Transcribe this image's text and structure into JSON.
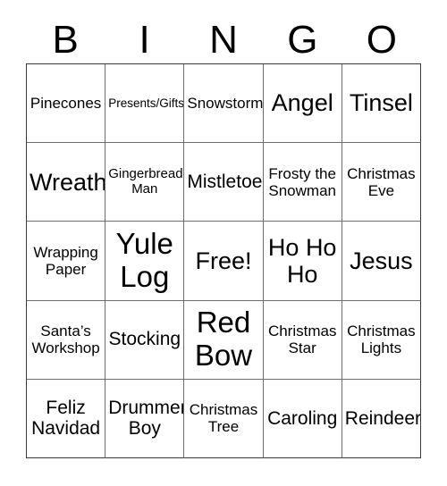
{
  "header": {
    "letters": [
      "B",
      "I",
      "N",
      "G",
      "O"
    ]
  },
  "grid": {
    "rows": 5,
    "columns": 5,
    "cells": [
      {
        "text": "Pinecones",
        "size": "md",
        "free": false
      },
      {
        "text": "Presents/Gifts",
        "size": "xs",
        "free": false
      },
      {
        "text": "Snowstorm",
        "size": "md",
        "free": false
      },
      {
        "text": "Angel",
        "size": "xl",
        "free": false
      },
      {
        "text": "Tinsel",
        "size": "xl",
        "free": false
      },
      {
        "text": "Wreath",
        "size": "xl",
        "free": false
      },
      {
        "text": "Gingerbread\nMan",
        "size": "sm",
        "free": false
      },
      {
        "text": "Mistletoe",
        "size": "lg",
        "free": false
      },
      {
        "text": "Frosty the\nSnowman",
        "size": "md",
        "free": false
      },
      {
        "text": "Christmas\nEve",
        "size": "md",
        "free": false
      },
      {
        "text": "Wrapping\nPaper",
        "size": "md",
        "free": false
      },
      {
        "text": "Yule\nLog",
        "size": "xxl",
        "free": false
      },
      {
        "text": "Free!",
        "size": "xl",
        "free": true
      },
      {
        "text": "Ho Ho\nHo",
        "size": "xl",
        "free": false
      },
      {
        "text": "Jesus",
        "size": "xl",
        "free": false
      },
      {
        "text": "Santa’s\nWorkshop",
        "size": "md",
        "free": false
      },
      {
        "text": "Stocking",
        "size": "lg",
        "free": false
      },
      {
        "text": "Red\nBow",
        "size": "xxl",
        "free": false
      },
      {
        "text": "Christmas\nStar",
        "size": "md",
        "free": false
      },
      {
        "text": "Christmas\nLights",
        "size": "md",
        "free": false
      },
      {
        "text": "Feliz\nNavidad",
        "size": "lg",
        "free": false
      },
      {
        "text": "Drummer\nBoy",
        "size": "lg",
        "free": false
      },
      {
        "text": "Christmas\nTree",
        "size": "md",
        "free": false
      },
      {
        "text": "Caroling",
        "size": "lg",
        "free": false
      },
      {
        "text": "Reindeer",
        "size": "lg",
        "free": false
      }
    ]
  },
  "colors": {
    "background": "#ffffff",
    "text": "#000000",
    "grid_line": "#6e6e6e",
    "grid_border": "#3a3a3a"
  }
}
